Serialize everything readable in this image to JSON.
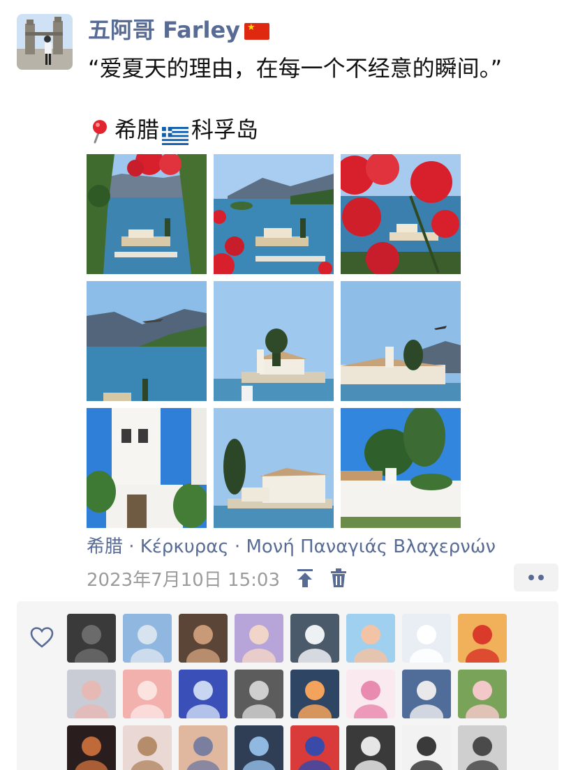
{
  "post": {
    "author_name": "五阿哥 Farley",
    "author_flag": "flag-china",
    "quote_line": "“爱夏天的理由，在每一个不经意的瞬间。”",
    "location_tag": {
      "pin_icon": "location-pin-icon",
      "country": "希腊",
      "flag": "flag-greece",
      "place": "科孚岛"
    },
    "photos": [
      {
        "name": "photo-harbor-flowers-left"
      },
      {
        "name": "photo-harbor-view"
      },
      {
        "name": "photo-flowers-foreground"
      },
      {
        "name": "photo-plane-over-coast"
      },
      {
        "name": "photo-monastery-island"
      },
      {
        "name": "photo-monastery-plane"
      },
      {
        "name": "photo-bell-tower"
      },
      {
        "name": "photo-monastery-cypress"
      },
      {
        "name": "photo-white-wall-tree"
      }
    ],
    "location_line": "希腊 · Κέρκυρας · Μονή Παναγιάς Βλαχερνών",
    "timestamp": "2023年7月10日 15:03",
    "actions": {
      "pin_icon": "pin-top-icon",
      "delete_icon": "trash-icon",
      "more_icon": "more-dots-icon"
    }
  },
  "likes": {
    "heart_icon": "heart-outline-icon",
    "avatars": [
      "liker-1",
      "liker-2",
      "liker-3",
      "liker-4",
      "liker-5",
      "liker-6",
      "liker-7",
      "liker-8",
      "liker-9",
      "liker-10",
      "liker-11",
      "liker-12",
      "liker-13",
      "liker-14",
      "liker-15",
      "liker-16",
      "liker-17",
      "liker-18",
      "liker-19",
      "liker-20",
      "liker-21",
      "liker-22",
      "liker-23",
      "liker-24"
    ]
  },
  "colors": {
    "link": "#576b95",
    "timestamp": "#9b9b9b",
    "likes_bg": "#f5f5f5"
  }
}
